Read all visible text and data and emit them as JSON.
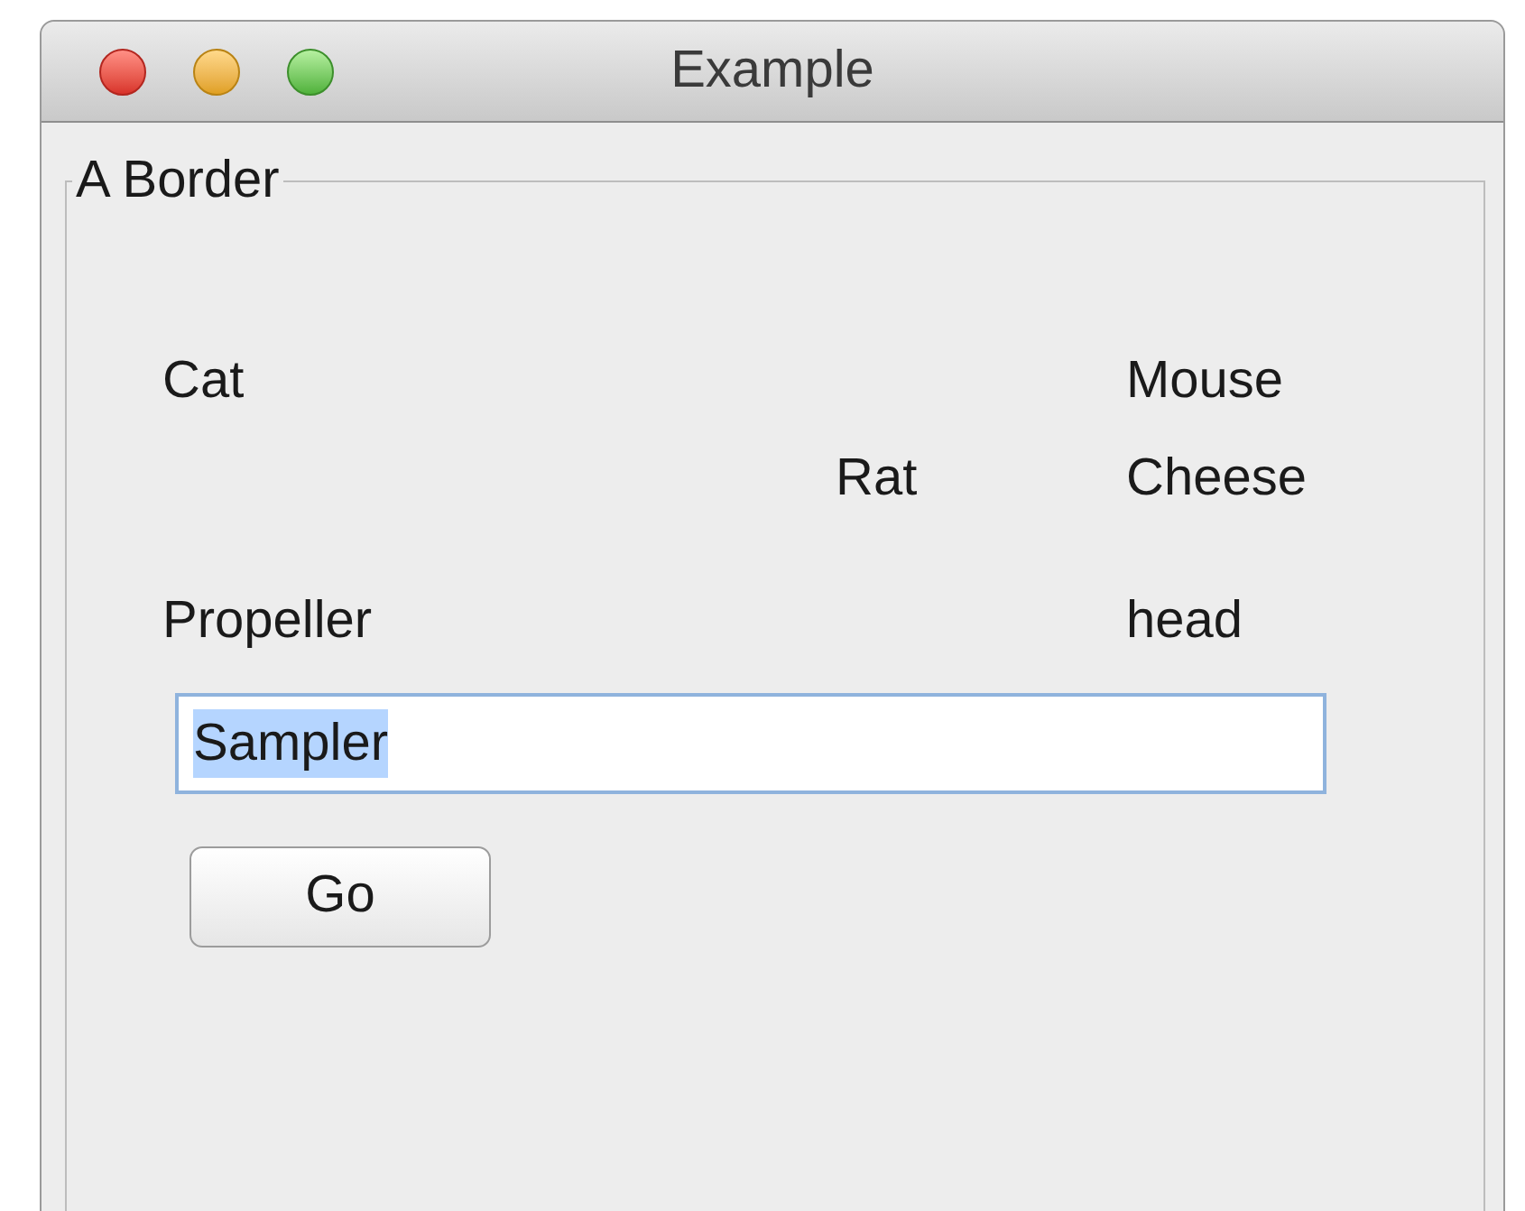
{
  "window": {
    "title": "Example"
  },
  "group": {
    "title": "A Border"
  },
  "label_rows": [
    {
      "column_1": "Cat",
      "column_3": "Mouse"
    },
    {
      "column_2": "Rat",
      "column_3": "Cheese"
    },
    {
      "column_1": "Propeller",
      "column_3": "head"
    }
  ],
  "field": {
    "value": "Sampler",
    "selected": true
  },
  "button": {
    "label": "Go"
  }
}
